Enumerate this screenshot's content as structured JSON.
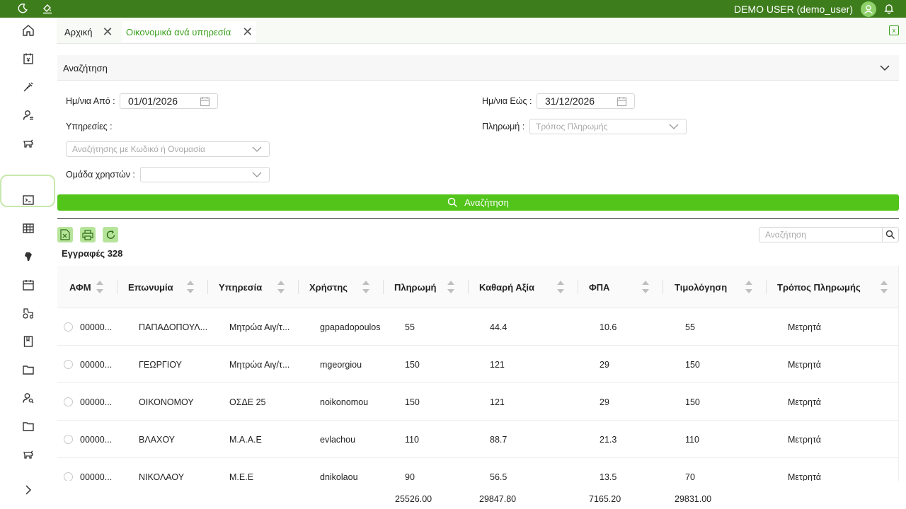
{
  "topbar": {
    "user": "DEMO USER (demo_user)",
    "color": "#3e7d1c"
  },
  "sidebar": {
    "items": [
      "home-icon",
      "invoice-icon",
      "syringe-icon",
      "user-manage-icon",
      "cow-icon",
      "blank",
      "terminal-icon",
      "grid-icon",
      "africa-icon",
      "calendar-icon",
      "tractor-icon",
      "book-icon",
      "folder-icon",
      "user-search-icon",
      "folder-icon",
      "cow-icon"
    ],
    "expand_icon": "chevron-right-icon"
  },
  "tabs": [
    {
      "label": "Αρχική"
    },
    {
      "label": "Οικονομικά ανά υπηρεσία"
    }
  ],
  "search_panel": {
    "title": "Αναζήτηση",
    "date_from_label": "Ημ/νια Από :",
    "date_from_value": "01/01/2026",
    "date_to_label": "Ημ/νια Εώς :",
    "date_to_value": "31/12/2026",
    "services_label": "Υπηρεσίες :",
    "services_placeholder": "Αναζήτησης με Κωδικό ή Ονομασία",
    "payment_label": "Πληρωμή :",
    "payment_placeholder": "Τρόπος Πληρωμής",
    "usergroup_label": "Ομάδα χρηστών :",
    "search_button": "Αναζήτηση"
  },
  "grid_tools": {
    "search_placeholder": "Αναζήτηση",
    "records_label": "Εγγραφές 328"
  },
  "table": {
    "columns": [
      "ΑΦΜ",
      "Επωνυμία",
      "Υπηρεσία",
      "Χρήστης",
      "Πληρωμή",
      "Καθαρή Αξία",
      "ΦΠΑ",
      "Τιμολόγηση",
      "Τρόπος Πληρωμής"
    ],
    "rows": [
      [
        "00000...",
        "ΠΑΠΑΔΟΠΟΥΛ...",
        "Μητρώα Αιγ/τ...",
        "gpapadopoulos",
        "55",
        "44.4",
        "10.6",
        "55",
        "Μετρητά"
      ],
      [
        "00000...",
        "ΓΕΩΡΓΙΟΥ",
        "Μητρώα Αιγ/τ...",
        "mgeorgiou",
        "150",
        "121",
        "29",
        "150",
        "Μετρητά"
      ],
      [
        "00000...",
        "ΟΙΚΟΝΟΜΟΥ",
        "ΟΣΔΕ 25",
        "noikonomou",
        "150",
        "121",
        "29",
        "150",
        "Μετρητά"
      ],
      [
        "00000...",
        "ΒΛΑΧΟΥ",
        "Μ.Α.Α.Ε",
        "evlachou",
        "110",
        "88.7",
        "21.3",
        "110",
        "Μετρητά"
      ],
      [
        "00000...",
        "ΝΙΚΟΛΑΟΥ",
        "Μ.Ε.Ε",
        "dnikolaou",
        "90",
        "56.5",
        "13.5",
        "70",
        "Μετρητά"
      ]
    ],
    "totals": {
      "payment": "25526.00",
      "net": "29847.80",
      "vat": "7165.20",
      "invoicing": "29831.00"
    }
  }
}
